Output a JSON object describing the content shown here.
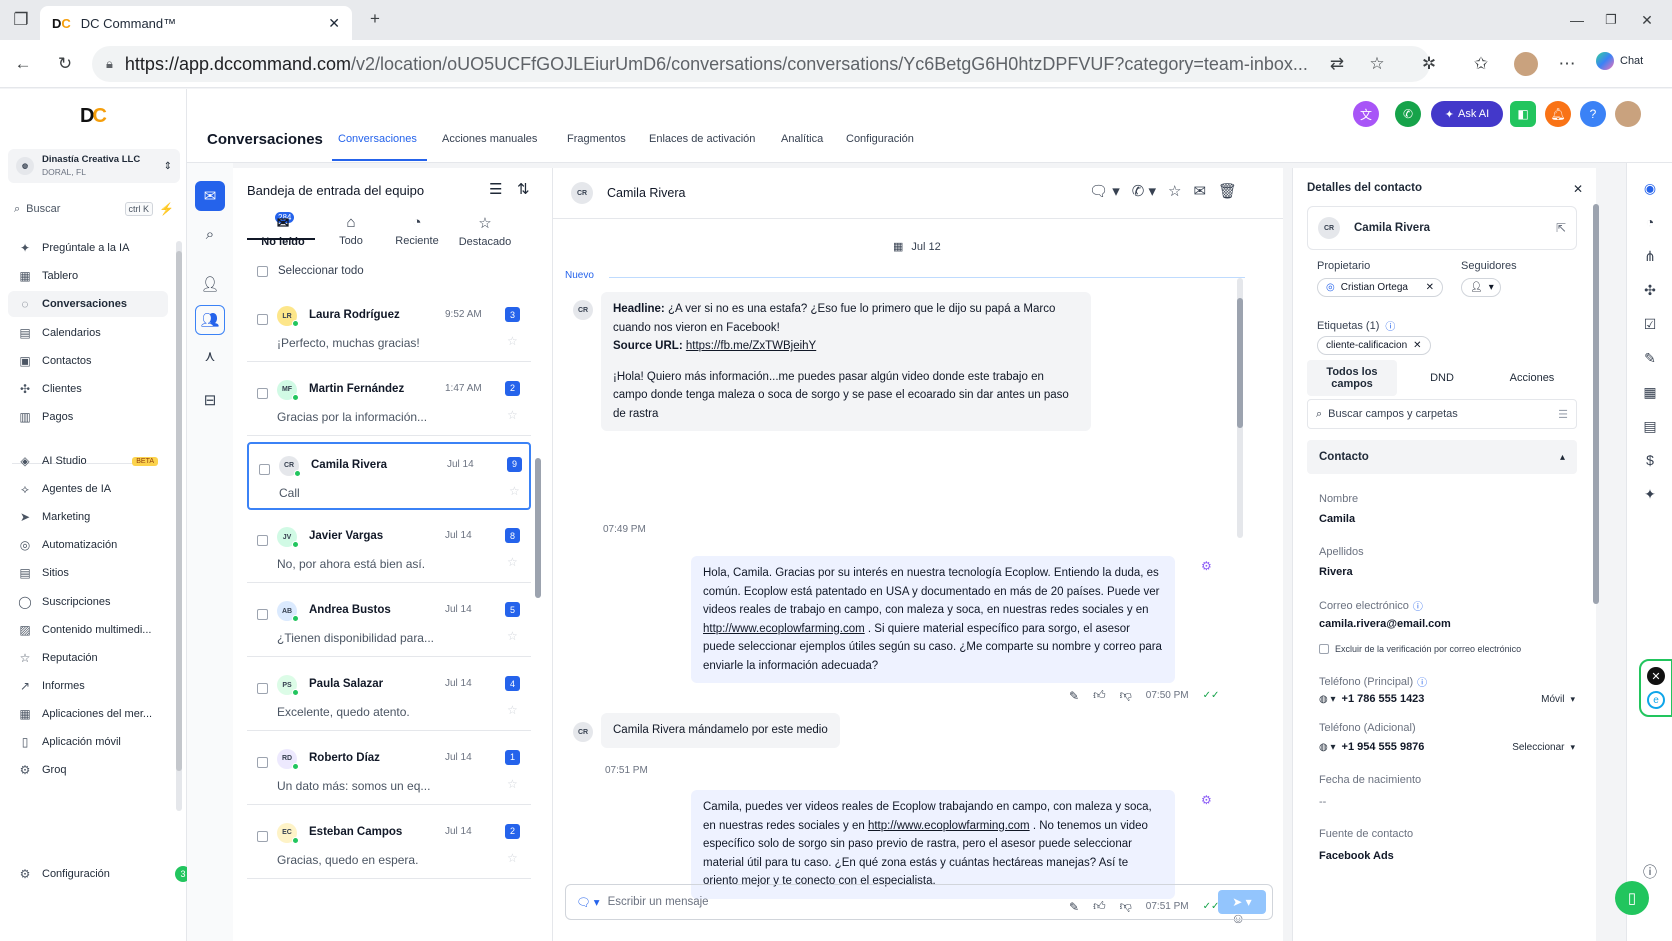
{
  "browser": {
    "tab_title": "DC Command™",
    "url_host": "https://app.dccommand.com",
    "url_path": "/v2/location/oUO5UCFfGOJLEiurUmD6/conversations/conversations/Yc6BetgG6H0htzDPFVUF?category=team-inbox...",
    "chat_label": "Chat"
  },
  "sidebar": {
    "account_name": "Dinastía Creativa LLC",
    "account_location": "DORAL, FL",
    "search_placeholder": "Buscar",
    "search_shortcut": "ctrl K",
    "items": [
      {
        "label": "Pregúntale a la IA",
        "icon": "✦"
      },
      {
        "label": "Tablero",
        "icon": "▦"
      },
      {
        "label": "Conversaciones",
        "icon": "◌"
      },
      {
        "label": "Calendarios",
        "icon": "▤"
      },
      {
        "label": "Contactos",
        "icon": "▣"
      },
      {
        "label": "Clientes",
        "icon": "✣"
      },
      {
        "label": "Pagos",
        "icon": "▥"
      }
    ],
    "items2": [
      {
        "label": "AI Studio",
        "icon": "◈",
        "badge": "BETA"
      },
      {
        "label": "Agentes de IA",
        "icon": "⟡"
      },
      {
        "label": "Marketing",
        "icon": "➤"
      },
      {
        "label": "Automatización",
        "icon": "◎"
      },
      {
        "label": "Sitios",
        "icon": "▤"
      },
      {
        "label": "Suscripciones",
        "icon": "◯"
      },
      {
        "label": "Contenido multimedi...",
        "icon": "▨"
      },
      {
        "label": "Reputación",
        "icon": "☆"
      },
      {
        "label": "Informes",
        "icon": "↗"
      },
      {
        "label": "Aplicaciones del mer...",
        "icon": "▦"
      },
      {
        "label": "Aplicación móvil",
        "icon": "▯"
      },
      {
        "label": "Groq",
        "icon": "⚙"
      }
    ],
    "settings_label": "Configuración",
    "settings_badge": "3"
  },
  "header": {
    "title": "Conversaciones",
    "tabs": [
      "Conversaciones",
      "Acciones manuales",
      "Fragmentos",
      "Enlaces de activación",
      "Analítica",
      "Configuración"
    ],
    "ask_ai": "Ask AI"
  },
  "list": {
    "title": "Bandeja de entrada del equipo",
    "unread_badge": "284",
    "filters": [
      {
        "label": "No leído",
        "icon": "✉"
      },
      {
        "label": "Todo",
        "icon": "⌂"
      },
      {
        "label": "Reciente",
        "icon": "◔"
      },
      {
        "label": "Destacado",
        "icon": "☆"
      }
    ],
    "select_all": "Seleccionar todo",
    "conversations": [
      {
        "initials": "LR",
        "name": "Laura Rodríguez",
        "time": "9:52 AM",
        "count": "3",
        "preview": "¡Perfecto, muchas gracias!"
      },
      {
        "initials": "MF",
        "name": "Martin Fernández",
        "time": "1:47 AM",
        "count": "2",
        "preview": "Gracias por la información..."
      },
      {
        "initials": "CR",
        "name": "Camila Rivera",
        "time": "Jul 14",
        "count": "9",
        "preview": "Call"
      },
      {
        "initials": "JV",
        "name": "Javier Vargas",
        "time": "Jul 14",
        "count": "8",
        "preview": "No, por ahora está bien así."
      },
      {
        "initials": "AB",
        "name": "Andrea Bustos",
        "time": "Jul 14",
        "count": "5",
        "preview": "¿Tienen disponibilidad para..."
      },
      {
        "initials": "PS",
        "name": "Paula Salazar",
        "time": "Jul 14",
        "count": "4",
        "preview": "Excelente,  quedo atento."
      },
      {
        "initials": "RD",
        "name": "Roberto Díaz",
        "time": "Jul 14",
        "count": "1",
        "preview": "Un dato más: somos un eq..."
      },
      {
        "initials": "EC",
        "name": "Esteban Campos",
        "time": "Jul 14",
        "count": "2",
        "preview": "Gracias, quedo en espera."
      }
    ]
  },
  "chat": {
    "contact_initials": "CR",
    "contact_name": "Camila Rivera",
    "date_label": "Jul 12",
    "new_label": "Nuevo",
    "msg1": {
      "headline_label": "Headline:",
      "headline": " ¿A ver si no es una estafa? ¿Eso fue lo primero que le dijo su papá a Marco cuando nos vieron en Facebook!",
      "source_label": "Source URL:",
      "source_url": "https://fb.me/ZxTWBjeihY",
      "body": "¡Hola! Quiero más información...me puedes pasar algún video donde este trabajo en campo donde tenga maleza o soca de sorgo y se pase el ecoarado sin dar antes un paso de rastra",
      "time": "07:49 PM"
    },
    "msg2": {
      "text_a": "Hola, Camila. Gracias por su interés en nuestra tecnología Ecoplow. Entiendo la duda, es común. Ecoplow está patentado en USA y documentado en más de 20 países. Puede ver videos reales de trabajo en campo, con maleza y soca, en nuestras redes sociales y en ",
      "link": "http://www.ecoplowfarming.com",
      "text_b": " . Si quiere material específico para sorgo, el asesor puede seleccionar ejemplos útiles según su caso. ¿Me comparte su nombre y correo para enviarle la información adecuada?",
      "time": "07:50 PM"
    },
    "msg3": {
      "text": "Camila Rivera mándamelo por este medio",
      "time": "07:51 PM"
    },
    "msg4": {
      "text_a": "Camila, puedes ver videos reales de Ecoplow trabajando en campo, con maleza y soca, en nuestras redes sociales y en ",
      "link": "http://www.ecoplowfarming.com",
      "text_b": " . No tenemos un video específico solo de sorgo sin paso previo de rastra, pero el asesor puede seleccionar material útil para tu caso. ¿En qué zona estás y cuántas hectáreas manejas? Así te oriento mejor y te conecto con el especialista.",
      "time": "07:51 PM"
    },
    "composer_placeholder": "Escribir un mensaje"
  },
  "contact": {
    "panel_title": "Detalles del contacto",
    "initials": "CR",
    "name": "Camila Rivera",
    "owner_label": "Propietario",
    "owner": "Cristian Ortega",
    "followers_label": "Seguidores",
    "tags_label": "Etiquetas (1)",
    "tag": "cliente-calificacion",
    "tabs": [
      "Todos los campos",
      "DND",
      "Acciones"
    ],
    "search_placeholder": "Buscar campos y carpetas",
    "section_title": "Contacto",
    "fields": {
      "first_name_label": "Nombre",
      "first_name": "Camila",
      "last_name_label": "Apellidos",
      "last_name": "Rivera",
      "email_label": "Correo electrónico",
      "email": "camila.rivera@email.com",
      "exclude_label": "Excluir de la verificación por correo electrónico",
      "phone_label": "Teléfono (Principal)",
      "phone": "+1 786 555 1423",
      "phone_type": "Móvil",
      "phone2_label": "Teléfono (Adicional)",
      "phone2": "+1 954 555 9876",
      "phone2_type": "Seleccionar",
      "birth_label": "Fecha de nacimiento",
      "birth": "--",
      "source_label": "Fuente de contacto",
      "source": "Facebook Ads"
    }
  }
}
